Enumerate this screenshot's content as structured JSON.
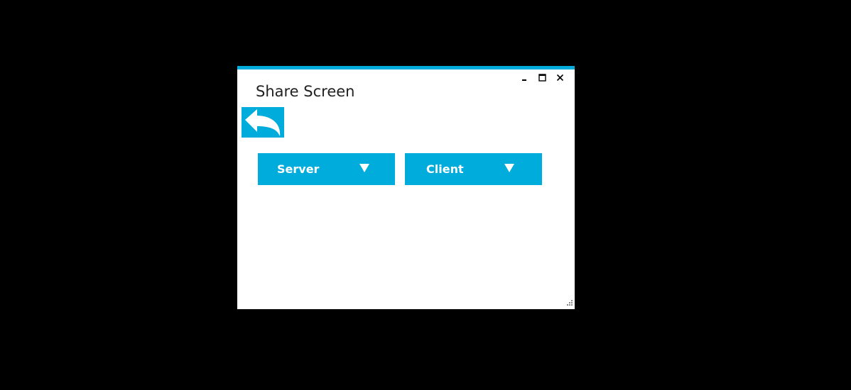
{
  "colors": {
    "accent": "#00ACDC",
    "background": "#000000",
    "window": "#FFFFFF",
    "text": "#222222"
  },
  "window": {
    "title": "Share Screen",
    "controls": {
      "minimize_icon": "minimize-icon",
      "maximize_icon": "maximize-icon",
      "close_icon": "close-icon"
    }
  },
  "back_button": {
    "icon": "back-arrow-icon"
  },
  "dropdowns": [
    {
      "label": "Server",
      "icon": "triangle-down-icon"
    },
    {
      "label": "Client",
      "icon": "triangle-down-icon"
    }
  ]
}
